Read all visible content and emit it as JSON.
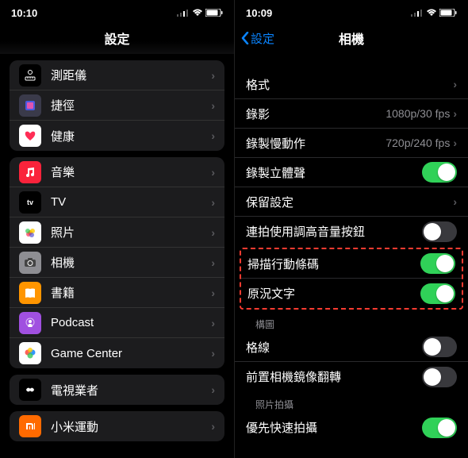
{
  "left": {
    "status_time": "10:10",
    "nav_title": "設定",
    "group1": [
      {
        "label": "測距儀",
        "icon": "ruler",
        "bg": "#000"
      },
      {
        "label": "捷徑",
        "icon": "shortcuts",
        "bg": "#3a3a4a"
      },
      {
        "label": "健康",
        "icon": "heart",
        "bg": "#fff"
      }
    ],
    "group2": [
      {
        "label": "音樂",
        "icon": "music",
        "bg": "#fa233b"
      },
      {
        "label": "TV",
        "icon": "tv",
        "bg": "#000"
      },
      {
        "label": "照片",
        "icon": "photos",
        "bg": "#fff"
      },
      {
        "label": "相機",
        "icon": "camera",
        "bg": "#8e8e93"
      },
      {
        "label": "書籍",
        "icon": "books",
        "bg": "#ff9500"
      },
      {
        "label": "Podcast",
        "icon": "podcast",
        "bg": "#a050e0"
      },
      {
        "label": "Game Center",
        "icon": "gamecenter",
        "bg": "#fff"
      }
    ],
    "group3": [
      {
        "label": "電視業者",
        "icon": "tvprovider",
        "bg": "#000"
      }
    ],
    "group4": [
      {
        "label": "小米運動",
        "icon": "xiaomi",
        "bg": "#ff6a00"
      }
    ]
  },
  "right": {
    "status_time": "10:09",
    "nav_back": "設定",
    "nav_title": "相機",
    "rows_top": [
      {
        "label": "格式",
        "type": "link"
      },
      {
        "label": "錄影",
        "value": "1080p/30 fps",
        "type": "link"
      },
      {
        "label": "錄製慢動作",
        "value": "720p/240 fps",
        "type": "link"
      },
      {
        "label": "錄製立體聲",
        "type": "toggle",
        "on": true
      },
      {
        "label": "保留設定",
        "type": "link"
      },
      {
        "label": "連拍使用調高音量按鈕",
        "type": "toggle",
        "on": false
      }
    ],
    "rows_highlight": [
      {
        "label": "掃描行動條碼",
        "type": "toggle",
        "on": true
      },
      {
        "label": "原況文字",
        "type": "toggle",
        "on": true
      }
    ],
    "section_composition": "構圖",
    "rows_composition": [
      {
        "label": "格線",
        "type": "toggle",
        "on": false
      },
      {
        "label": "前置相機鏡像翻轉",
        "type": "toggle",
        "on": false
      }
    ],
    "section_photo": "照片拍攝",
    "rows_photo": [
      {
        "label": "優先快速拍攝",
        "type": "toggle",
        "on": true
      }
    ]
  }
}
